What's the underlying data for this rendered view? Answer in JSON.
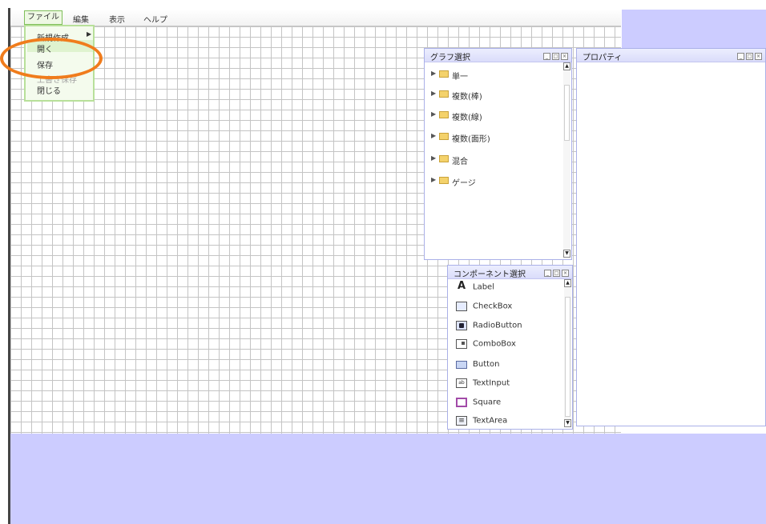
{
  "menubar": {
    "file": "ファイル",
    "edit": "編集",
    "view": "表示",
    "help": "ヘルプ"
  },
  "file_menu": {
    "items": [
      "新規作成",
      "開く",
      "保存",
      "上書き保存",
      "閉じる"
    ],
    "submenu_arrow": "▶"
  },
  "graph_panel": {
    "title": "グラフ選択",
    "items": [
      "単一",
      "複数(棒)",
      "複数(線)",
      "複数(面形)",
      "混合",
      "ゲージ"
    ]
  },
  "component_panel": {
    "title": "コンポーネント選択",
    "items": [
      {
        "label": "Label",
        "icon": "label-icon",
        "glyph": "A"
      },
      {
        "label": "CheckBox",
        "icon": "checkbox-icon",
        "glyph": "☑"
      },
      {
        "label": "RadioButton",
        "icon": "radiobutton-icon",
        "glyph": "◉"
      },
      {
        "label": "ComboBox",
        "icon": "combobox-icon",
        "glyph": ""
      },
      {
        "label": "Button",
        "icon": "button-icon",
        "glyph": ""
      },
      {
        "label": "TextInput",
        "icon": "textinput-icon",
        "glyph": "ab"
      },
      {
        "label": "Square",
        "icon": "square-icon",
        "glyph": ""
      },
      {
        "label": "TextArea",
        "icon": "textarea-icon",
        "glyph": "≡"
      }
    ]
  },
  "property_panel": {
    "title": "プロパティ"
  },
  "colors": {
    "workspace_bg": "#ccccff",
    "highlight_circle": "#f07c1c",
    "menu_active": "#b8e09a",
    "panel_border": "#aab0e8"
  }
}
